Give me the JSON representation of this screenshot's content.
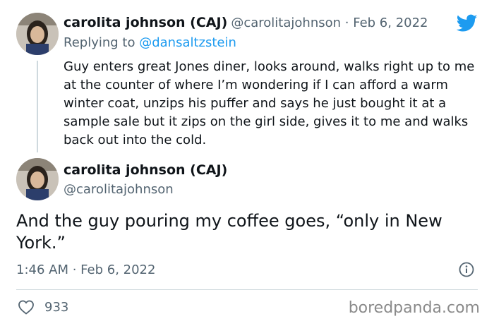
{
  "reply_tweet": {
    "author_name": "carolita johnson (CAJ)",
    "author_handle": "@carolitajohnson",
    "separator": " · ",
    "date": "Feb 6, 2022",
    "replying_prefix": "Replying to ",
    "replying_to": "@dansaltzstein",
    "text": "Guy enters great Jones diner, looks around, walks right up to me at the counter of where I’m  wondering if I can afford a warm winter coat, unzips his puffer and says he just bought it at a sample sale but it zips on the girl side, gives it to me and walks back out into the cold."
  },
  "main_tweet": {
    "author_name": "carolita johnson (CAJ)",
    "author_handle": "@carolitajohnson",
    "text": "And the guy pouring my coffee goes, “only in New York.”",
    "timestamp": "1:46 AM · Feb 6, 2022",
    "like_count": "933"
  },
  "watermark": "boredpanda.com",
  "icons": {
    "brand": "twitter-bird-icon",
    "info": "info-icon",
    "like": "heart-icon"
  },
  "colors": {
    "twitter_blue": "#1d9bf0",
    "secondary_text": "#536471",
    "divider": "#cfd9de"
  }
}
